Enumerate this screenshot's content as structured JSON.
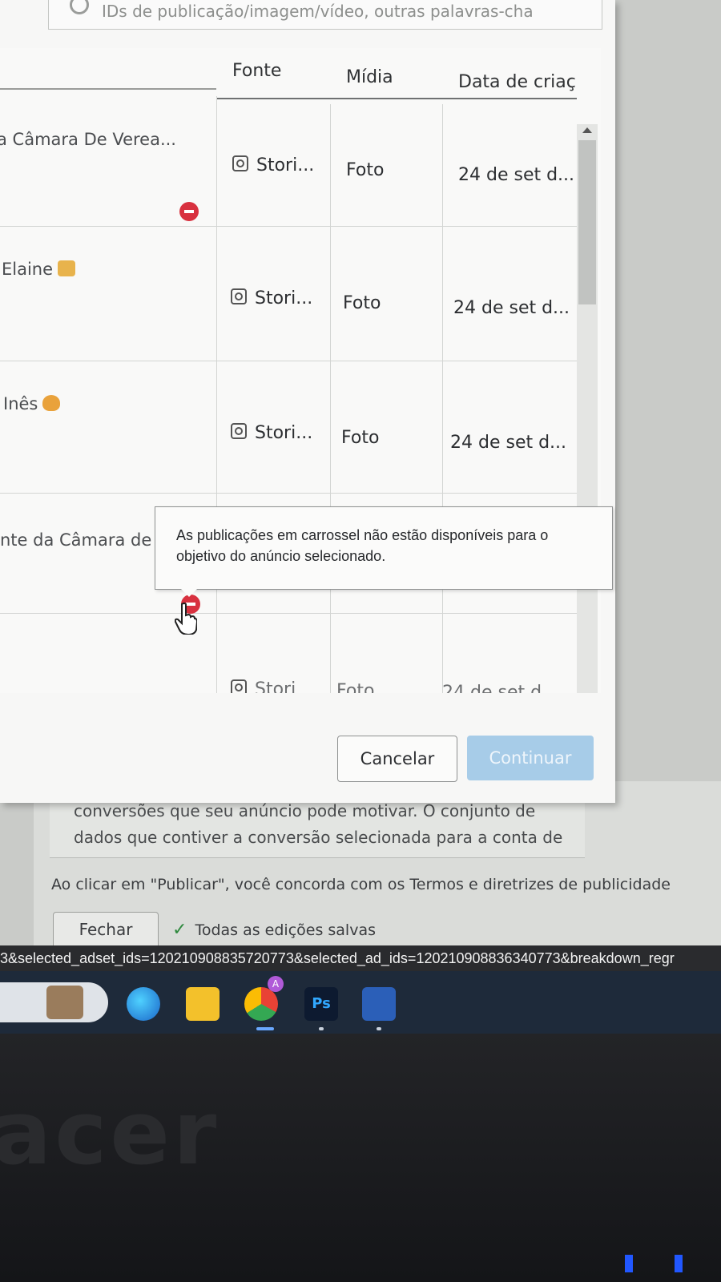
{
  "search": {
    "placeholder": "IDs de publicação/imagem/vídeo, outras palavras-cha"
  },
  "table": {
    "columns": [
      "Fonte",
      "Mídia",
      "Data de criaç"
    ],
    "rows": [
      {
        "name": "a Câmara De Verea...",
        "source": "Stori...",
        "media": "Foto",
        "date": "24 de set d...",
        "blocked": true
      },
      {
        "name": "Elaine",
        "source": "Stori...",
        "media": "Foto",
        "date": "24 de set d...",
        "blocked": false
      },
      {
        "name": "Inês",
        "source": "Stori...",
        "media": "Foto",
        "date": "24 de set d...",
        "blocked": false
      },
      {
        "name": "nte da Câmara de",
        "source": "",
        "media": "",
        "date": "",
        "blocked": true
      },
      {
        "name": "",
        "source": "Stori",
        "media": "Foto",
        "date": "24 de set d",
        "blocked": false
      }
    ]
  },
  "tooltip": {
    "text": "As publicações em carrossel não estão disponíveis para o objetivo do anúncio selecionado."
  },
  "buttons": {
    "cancel": "Cancelar",
    "continue": "Continuar"
  },
  "background": {
    "line1": "conversões que seu anúncio pode motivar. O conjunto de",
    "line2": "dados que contiver a conversão selecionada para a conta de",
    "terms": "Ao clicar em \"Publicar\", você concorda com os Termos e diretrizes de publicidade",
    "close": "Fechar",
    "saved": "Todas as edições salvas"
  },
  "url": "3&selected_adset_ids=120210908835720773&selected_ad_ids=120210908836340773&breakdown_regr",
  "taskbar": {
    "apps": [
      "edge-icon",
      "file-explorer-icon",
      "chrome-icon",
      "photoshop-icon",
      "word-icon"
    ],
    "chrome_badge": "A",
    "ps_label": "Ps"
  },
  "brand": "acer",
  "colors": {
    "continue_disabled": "#a7cce8",
    "block": "#d8313f"
  }
}
